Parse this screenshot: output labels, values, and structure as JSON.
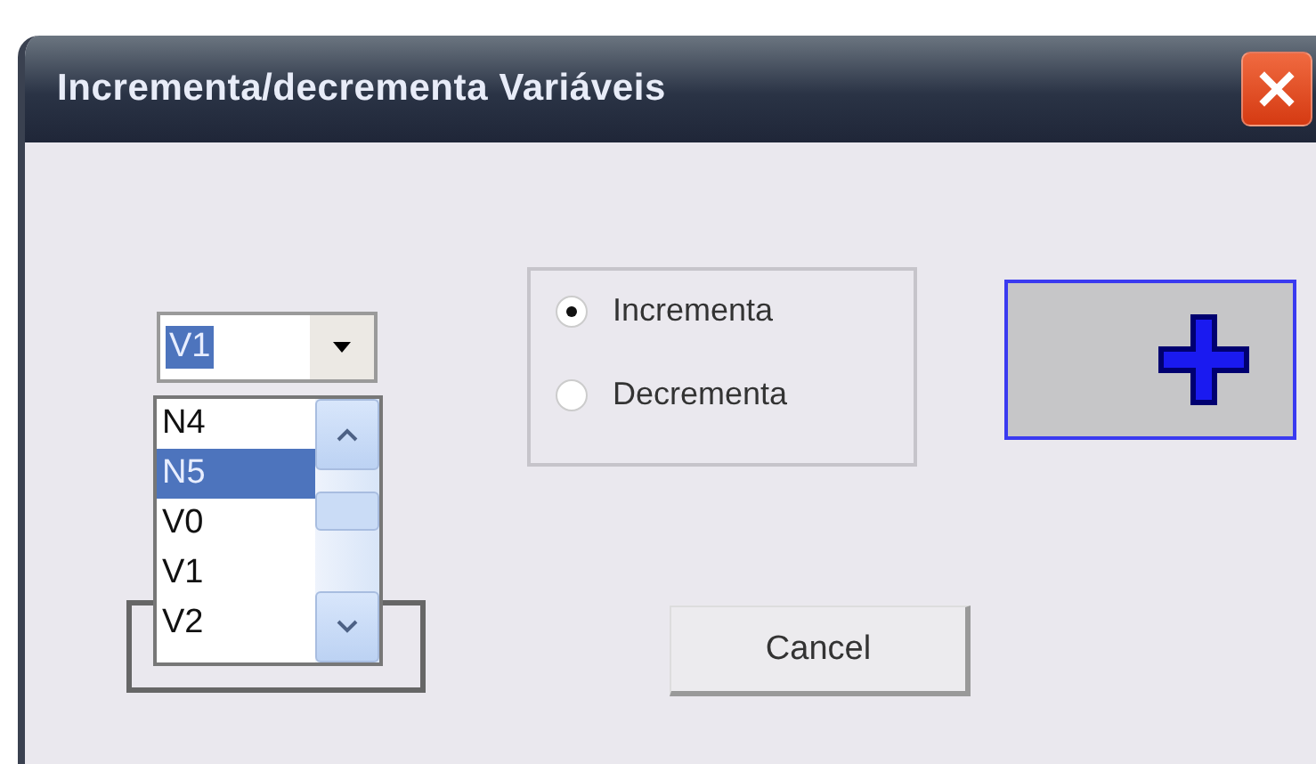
{
  "window": {
    "title": "Incrementa/decrementa Variáveis"
  },
  "combo": {
    "value": "V1"
  },
  "list_items": [
    {
      "label": "N4",
      "selected": false
    },
    {
      "label": "N5",
      "selected": true
    },
    {
      "label": "V0",
      "selected": false
    },
    {
      "label": "V1",
      "selected": false
    },
    {
      "label": "V2",
      "selected": false
    }
  ],
  "radio_options": [
    {
      "label": "Incrementa",
      "selected": true
    },
    {
      "label": "Decrementa",
      "selected": false
    }
  ],
  "buttons": [
    {
      "kind": "icon"
    },
    {
      "kind": "text",
      "label": "Cancel"
    }
  ]
}
